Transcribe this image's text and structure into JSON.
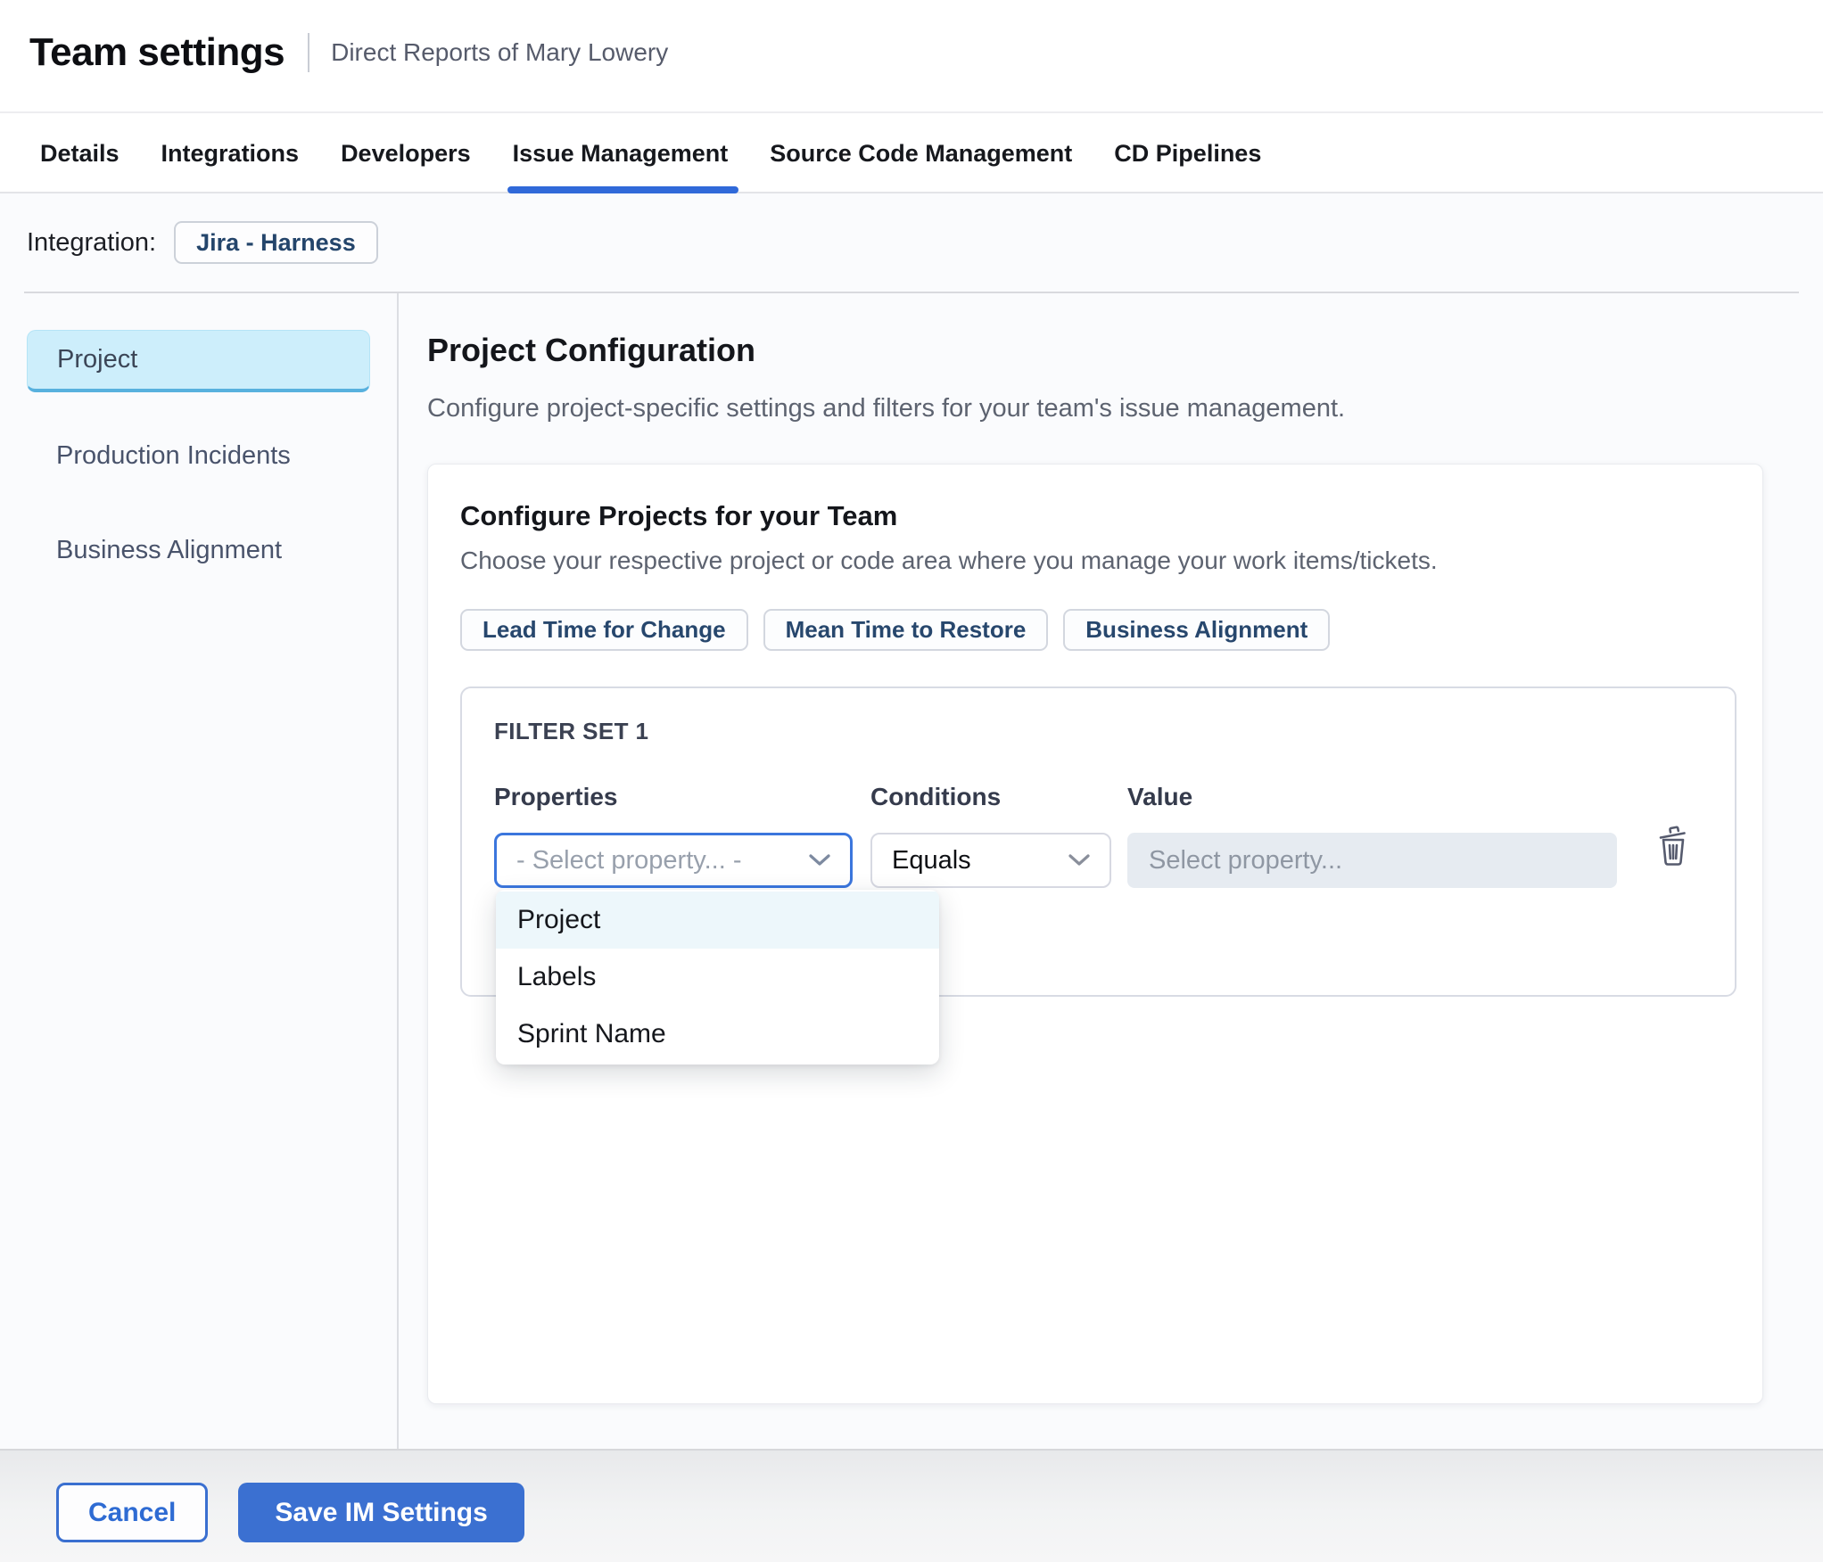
{
  "header": {
    "title": "Team settings",
    "subtitle": "Direct Reports of Mary Lowery"
  },
  "tabs": {
    "items": [
      "Details",
      "Integrations",
      "Developers",
      "Issue Management",
      "Source Code Management",
      "CD Pipelines"
    ],
    "active": "Issue Management"
  },
  "integration": {
    "label": "Integration:",
    "value": "Jira - Harness"
  },
  "sidebar": {
    "items": [
      {
        "label": "Project",
        "selected": true
      },
      {
        "label": "Production Incidents",
        "selected": false
      },
      {
        "label": "Business Alignment",
        "selected": false
      }
    ]
  },
  "main": {
    "title": "Project Configuration",
    "description": "Configure project-specific settings and filters for your team's issue management.",
    "card": {
      "title": "Configure Projects for your Team",
      "subtitle": "Choose your respective project or code area where you manage your work items/tickets.",
      "chips": [
        "Lead Time for Change",
        "Mean Time to Restore",
        "Business Alignment"
      ],
      "filter_set": {
        "title": "FILTER SET 1",
        "columns": {
          "properties": "Properties",
          "conditions": "Conditions",
          "value": "Value"
        },
        "property_select": {
          "value": "- Select property... -"
        },
        "condition_select": {
          "value": "Equals"
        },
        "value_input": {
          "placeholder": "Select property..."
        },
        "dropdown": {
          "items": [
            "Project",
            "Labels",
            "Sprint Name"
          ],
          "highlighted": "Project"
        }
      }
    }
  },
  "footer": {
    "cancel_label": "Cancel",
    "save_label": "Save IM Settings"
  },
  "colors": {
    "primary_blue": "#3b70d1",
    "tab_underline": "#3069d9",
    "focus_border": "#3b76dd",
    "selected_sidebar_bg": "#cdeefb",
    "selected_sidebar_border": "#58b1de",
    "dropdown_highlight": "#edf7fb",
    "chip_text": "#27476d",
    "value_input_bg": "#e6ebf1"
  }
}
